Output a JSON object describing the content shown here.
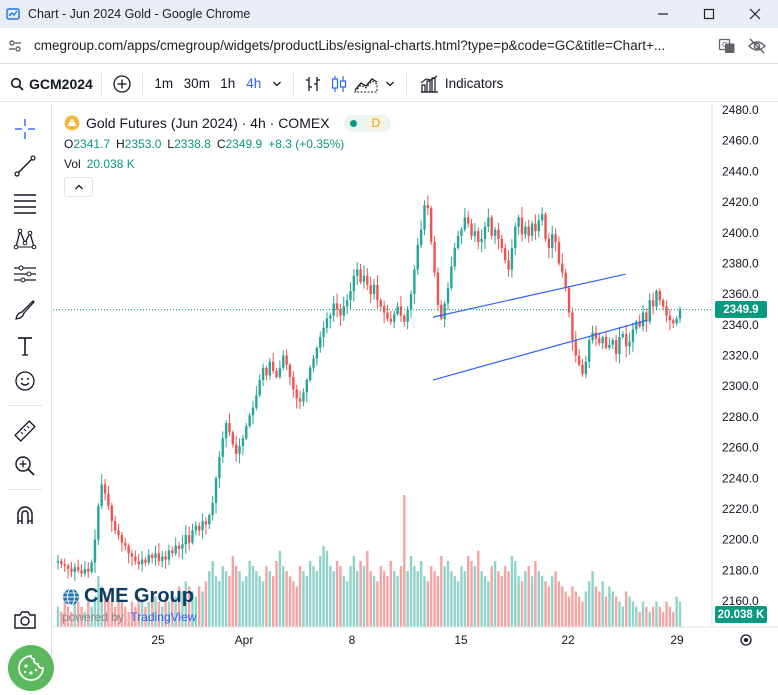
{
  "window": {
    "title": "Chart - Jun 2024 Gold - Google Chrome",
    "url": "cmegroup.com/apps/cmegroup/widgets/productLibs/esignal-charts.html?type=p&code=GC&title=Chart+..."
  },
  "toolbar": {
    "symbol": "GCM2024",
    "intervals": [
      "1m",
      "30m",
      "1h",
      "4h"
    ],
    "active_interval": "4h",
    "indicators_label": "Indicators"
  },
  "legend": {
    "title": "Gold Futures (Jun 2024) · 4h · COMEX",
    "status_badge": "D",
    "o_label": "O",
    "o_value": "2341.7",
    "h_label": "H",
    "h_value": "2353.0",
    "l_label": "L",
    "l_value": "2338.8",
    "c_label": "C",
    "c_value": "2349.9",
    "change": "+8.3 (+0.35%)",
    "vol_label": "Vol",
    "vol_value": "20.038 K"
  },
  "price_axis": {
    "ticks": [
      "2480.0",
      "2460.0",
      "2440.0",
      "2420.0",
      "2400.0",
      "2380.0",
      "2360.0",
      "2340.0",
      "2320.0",
      "2300.0",
      "2280.0",
      "2260.0",
      "2240.0",
      "2220.0",
      "2200.0",
      "2180.0",
      "2160.0"
    ],
    "last_price": "2349.9",
    "last_volume": "20.038 K"
  },
  "time_axis": {
    "ticks": [
      "25",
      "Apr",
      "8",
      "15",
      "22",
      "29"
    ]
  },
  "watermark": {
    "brand": "CME Group",
    "powered_by": "powered by",
    "provider": "TradingView"
  },
  "colors": {
    "up": "#26a69a",
    "down": "#ef5350",
    "channel": "#2962ff",
    "price_tag": "#089981"
  },
  "chart_data": {
    "type": "candlestick",
    "title": "Gold Futures (Jun 2024) · 4h · COMEX",
    "ylim": [
      2150,
      2485
    ],
    "x_ticks": [
      "25",
      "Apr",
      "8",
      "15",
      "22",
      "29"
    ],
    "last_close": 2349.9,
    "channel": {
      "upper": [
        [
          0.574,
          2345
        ],
        [
          0.868,
          2373
        ]
      ],
      "lower": [
        [
          0.574,
          2304
        ],
        [
          0.901,
          2343
        ]
      ]
    },
    "series": [
      {
        "name": "price",
        "closes": [
          2186,
          2184,
          2183,
          2181,
          2179,
          2182,
          2180,
          2178,
          2181,
          2179,
          2185,
          2200,
          2222,
          2236,
          2230,
          2222,
          2212,
          2206,
          2203,
          2198,
          2196,
          2191,
          2189,
          2186,
          2184,
          2187,
          2185,
          2190,
          2188,
          2191,
          2186,
          2189,
          2187,
          2193,
          2191,
          2196,
          2194,
          2197,
          2203,
          2198,
          2206,
          2209,
          2206,
          2212,
          2210,
          2216,
          2224,
          2240,
          2254,
          2266,
          2276,
          2270,
          2262,
          2256,
          2261,
          2266,
          2274,
          2281,
          2286,
          2294,
          2304,
          2312,
          2307,
          2316,
          2310,
          2306,
          2312,
          2320,
          2314,
          2306,
          2298,
          2292,
          2290,
          2296,
          2304,
          2312,
          2318,
          2325,
          2332,
          2338,
          2344,
          2346,
          2354,
          2350,
          2346,
          2352,
          2356,
          2362,
          2372,
          2376,
          2368,
          2372,
          2366,
          2360,
          2366,
          2356,
          2352,
          2348,
          2344,
          2342,
          2347,
          2352,
          2346,
          2342,
          2350,
          2360,
          2376,
          2392,
          2402,
          2418,
          2416,
          2394,
          2374,
          2353,
          2344,
          2354,
          2364,
          2378,
          2390,
          2398,
          2402,
          2410,
          2406,
          2398,
          2401,
          2394,
          2396,
          2404,
          2410,
          2398,
          2402,
          2396,
          2390,
          2382,
          2376,
          2390,
          2404,
          2410,
          2399,
          2404,
          2398,
          2406,
          2401,
          2408,
          2412,
          2396,
          2390,
          2399,
          2394,
          2380,
          2374,
          2364,
          2348,
          2330,
          2320,
          2314,
          2308,
          2316,
          2330,
          2335,
          2331,
          2328,
          2332,
          2325,
          2327,
          2330,
          2321,
          2332,
          2334,
          2326,
          2329,
          2337,
          2342,
          2339,
          2348,
          2342,
          2356,
          2352,
          2362,
          2356,
          2352,
          2346,
          2343,
          2341,
          2344,
          2350
        ]
      }
    ],
    "volume": [
      4,
      3,
      5,
      4,
      3,
      6,
      5,
      4,
      3,
      5,
      4,
      6,
      10,
      8,
      7,
      6,
      5,
      4,
      6,
      5,
      4,
      3,
      5,
      4,
      6,
      5,
      4,
      5,
      7,
      6,
      5,
      4,
      6,
      5,
      7,
      6,
      8,
      7,
      9,
      8,
      7,
      6,
      8,
      7,
      9,
      11,
      13,
      10,
      9,
      12,
      11,
      10,
      14,
      12,
      11,
      9,
      10,
      13,
      12,
      11,
      10,
      9,
      12,
      11,
      10,
      13,
      15,
      12,
      11,
      10,
      9,
      8,
      12,
      11,
      10,
      13,
      12,
      11,
      14,
      16,
      15,
      12,
      11,
      13,
      12,
      10,
      9,
      12,
      14,
      11,
      13,
      12,
      15,
      11,
      10,
      9,
      12,
      11,
      10,
      13,
      11,
      10,
      12,
      26,
      11,
      14,
      12,
      11,
      13,
      10,
      9,
      12,
      11,
      10,
      14,
      12,
      13,
      11,
      10,
      9,
      12,
      11,
      14,
      13,
      12,
      15,
      11,
      10,
      9,
      12,
      13,
      11,
      10,
      12,
      11,
      14,
      13,
      10,
      9,
      11,
      12,
      10,
      13,
      11,
      10,
      9,
      8,
      10,
      11,
      9,
      8,
      7,
      6,
      8,
      7,
      6,
      5,
      7,
      9,
      11,
      8,
      7,
      9,
      6,
      8,
      7,
      6,
      5,
      4,
      7,
      6,
      5,
      4,
      3,
      5,
      4,
      3,
      4,
      5
    ]
  }
}
